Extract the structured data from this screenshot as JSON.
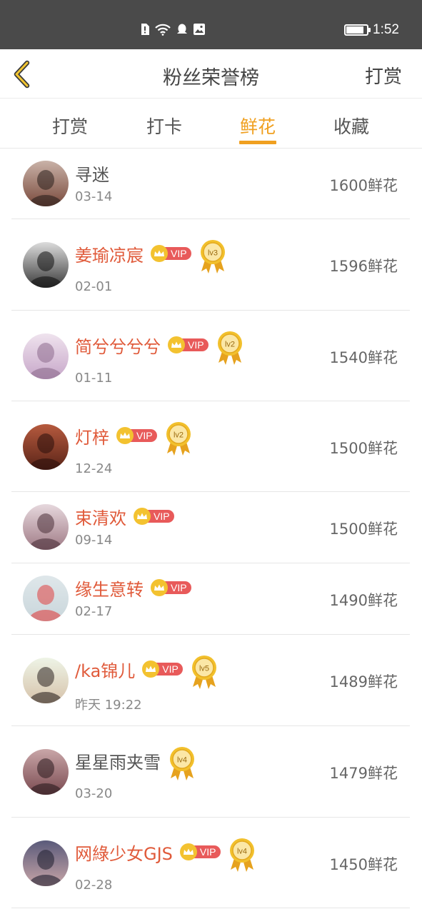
{
  "status_bar": {
    "time": "1:52",
    "battery_level": 0.85
  },
  "header": {
    "back_icon": "chevron-left-icon",
    "title": "粉丝荣誉榜",
    "action_label": "打赏"
  },
  "tabs": [
    {
      "label": "打赏",
      "active": false
    },
    {
      "label": "打卡",
      "active": false
    },
    {
      "label": "鲜花",
      "active": true
    },
    {
      "label": "收藏",
      "active": false
    }
  ],
  "colors": {
    "accent": "#f0a020",
    "vip_name": "#e05a3a",
    "vip_pill": "#e85a5a",
    "crown": "#f3c230",
    "status_bar": "#4a4a4a"
  },
  "fans": [
    {
      "name": "寻迷",
      "date": "03-14",
      "amount": "1600鲜花",
      "vip": false,
      "level": null,
      "avatar_icon": "avatar-image"
    },
    {
      "name": "姜瑜凉宸",
      "date": "02-01",
      "amount": "1596鲜花",
      "vip": true,
      "level": "lv3",
      "avatar_icon": "avatar-image"
    },
    {
      "name": "简兮兮兮兮",
      "date": "01-11",
      "amount": "1540鲜花",
      "vip": true,
      "level": "lv2",
      "avatar_icon": "avatar-image"
    },
    {
      "name": "灯梓",
      "date": "12-24",
      "amount": "1500鲜花",
      "vip": true,
      "level": "lv2",
      "avatar_icon": "avatar-image"
    },
    {
      "name": "束清欢",
      "date": "09-14",
      "amount": "1500鲜花",
      "vip": true,
      "level": null,
      "avatar_icon": "avatar-image"
    },
    {
      "name": "缘生意转",
      "date": "02-17",
      "amount": "1490鲜花",
      "vip": true,
      "level": null,
      "avatar_icon": "avatar-image"
    },
    {
      "name": "/ka锦儿",
      "date": "昨天 19:22",
      "amount": "1489鲜花",
      "vip": true,
      "level": "lv5",
      "avatar_icon": "avatar-image"
    },
    {
      "name": "星星雨夹雪",
      "date": "03-20",
      "amount": "1479鲜花",
      "vip": false,
      "level": "lv4",
      "avatar_icon": "avatar-image"
    },
    {
      "name": "网綠少女GJS",
      "date": "02-28",
      "amount": "1450鲜花",
      "vip": true,
      "level": "lv4",
      "avatar_icon": "avatar-image"
    }
  ],
  "vip_label": "VIP"
}
